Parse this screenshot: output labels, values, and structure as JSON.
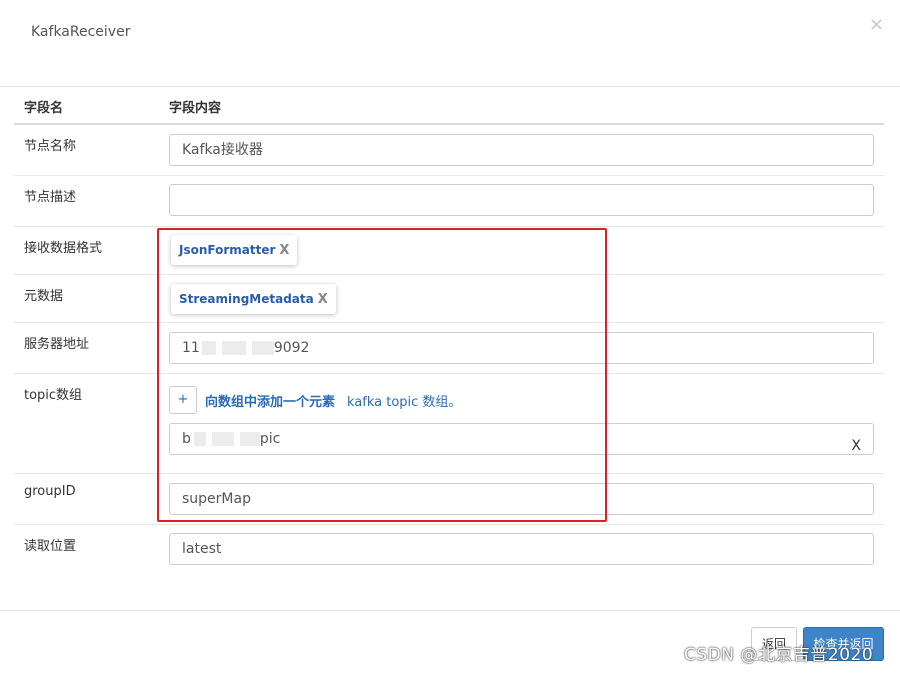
{
  "dialog": {
    "title": "KafkaReceiver",
    "close_glyph": "×"
  },
  "table": {
    "headers": [
      "字段名",
      "字段内容"
    ],
    "rows": {
      "node_name": {
        "label": "节点名称",
        "value": "Kafka接收器"
      },
      "node_desc": {
        "label": "节点描述",
        "value": ""
      },
      "format": {
        "label": "接收数据格式",
        "tag": "JsonFormatter",
        "remove": "X"
      },
      "metadata": {
        "label": "元数据",
        "tag": "StreamingMetadata",
        "remove": "X"
      },
      "server": {
        "label": "服务器地址",
        "value_prefix": "11",
        "value_suffix": "9092"
      },
      "topics": {
        "label": "topic数组",
        "add_glyph": "+",
        "add_text": "向数组中添加一个元素",
        "hint": "kafka topic 数组。",
        "item_prefix": "b",
        "item_suffix": "pic",
        "remove": "X"
      },
      "group": {
        "label": "groupID",
        "value": "superMap"
      },
      "offset": {
        "label": "读取位置",
        "value": "latest"
      }
    }
  },
  "footer": {
    "back_label": "返回",
    "check_label": "检查并返回"
  },
  "watermark": "CSDN @北京吉普2020",
  "colors": {
    "accent": "#3d84c8",
    "link": "#2a6bb8",
    "highlight_border": "#e02020"
  }
}
